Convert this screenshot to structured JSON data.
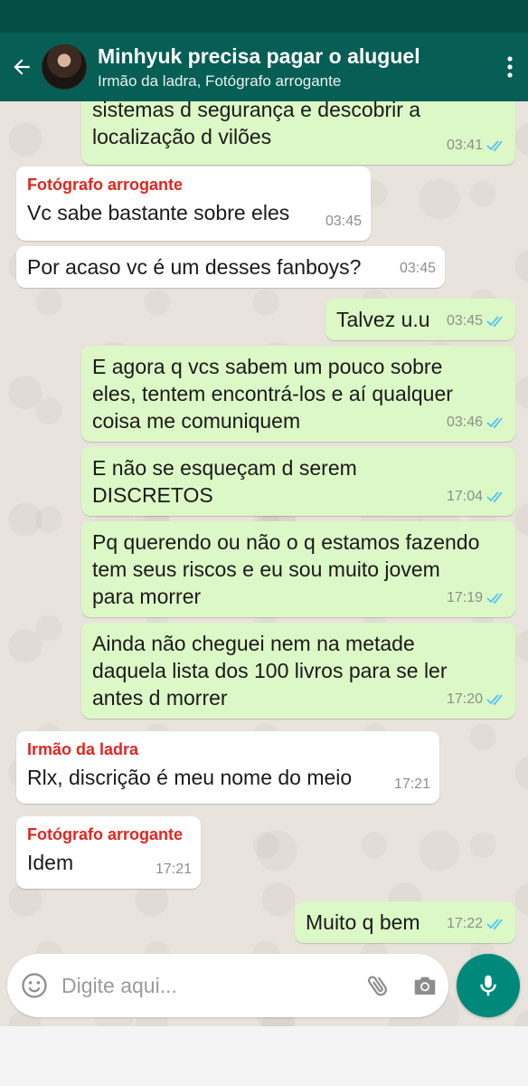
{
  "header": {
    "title": "Minhyuk precisa pagar o aluguel",
    "subtitle": "Irmão da ladra, Fotógrafo arrogante"
  },
  "messages": [
    {
      "text": "sistemas d segurança e descobrir a\nlocalização d vilões",
      "time": "03:41",
      "read": true
    },
    {
      "sender": "Fotógrafo arrogante",
      "text": "Vc sabe bastante sobre eles",
      "time": "03:45"
    },
    {
      "text": "Por acaso vc é um desses fanboys?",
      "time": "03:45"
    },
    {
      "text": "Talvez u.u",
      "time": "03:45",
      "read": true
    },
    {
      "text": "E agora q vcs sabem um pouco sobre\neles, tentem encontrá-los e aí qualquer\ncoisa me comuniquem",
      "time": "03:46",
      "read": true
    },
    {
      "text": "E não se esqueçam d serem\nDISCRETOS",
      "time": "17:04",
      "read": true
    },
    {
      "text": "Pq querendo ou não o q estamos fazendo\ntem seus riscos e eu sou muito jovem\npara morrer",
      "time": "17:19",
      "read": true
    },
    {
      "text": "Ainda não cheguei nem na metade\ndaquela lista dos 100 livros para se ler\nantes d morrer",
      "time": "17:20",
      "read": true
    },
    {
      "sender": "Irmão da ladra",
      "text": "Rlx, discrição é meu nome do meio",
      "time": "17:21"
    },
    {
      "sender": "Fotógrafo arrogante",
      "text": "Idem",
      "time": "17:21"
    },
    {
      "text": "Muito q bem",
      "time": "17:22",
      "read": true
    }
  ],
  "composer": {
    "placeholder": "Digite aqui..."
  },
  "icons": {
    "back": "arrow-left-icon",
    "menu": "more-vert-icon",
    "emoji": "emoji-icon",
    "attach": "paperclip-icon",
    "camera": "camera-icon",
    "mic": "mic-icon",
    "read": "double-check-icon"
  },
  "colors": {
    "header": "#075e54",
    "statusbar": "#054d44",
    "outgoing": "#dcf8c6",
    "incoming": "#ffffff",
    "sender_name": "#e0261f",
    "read_ticks": "#4fc3f7",
    "fab": "#00897b"
  }
}
